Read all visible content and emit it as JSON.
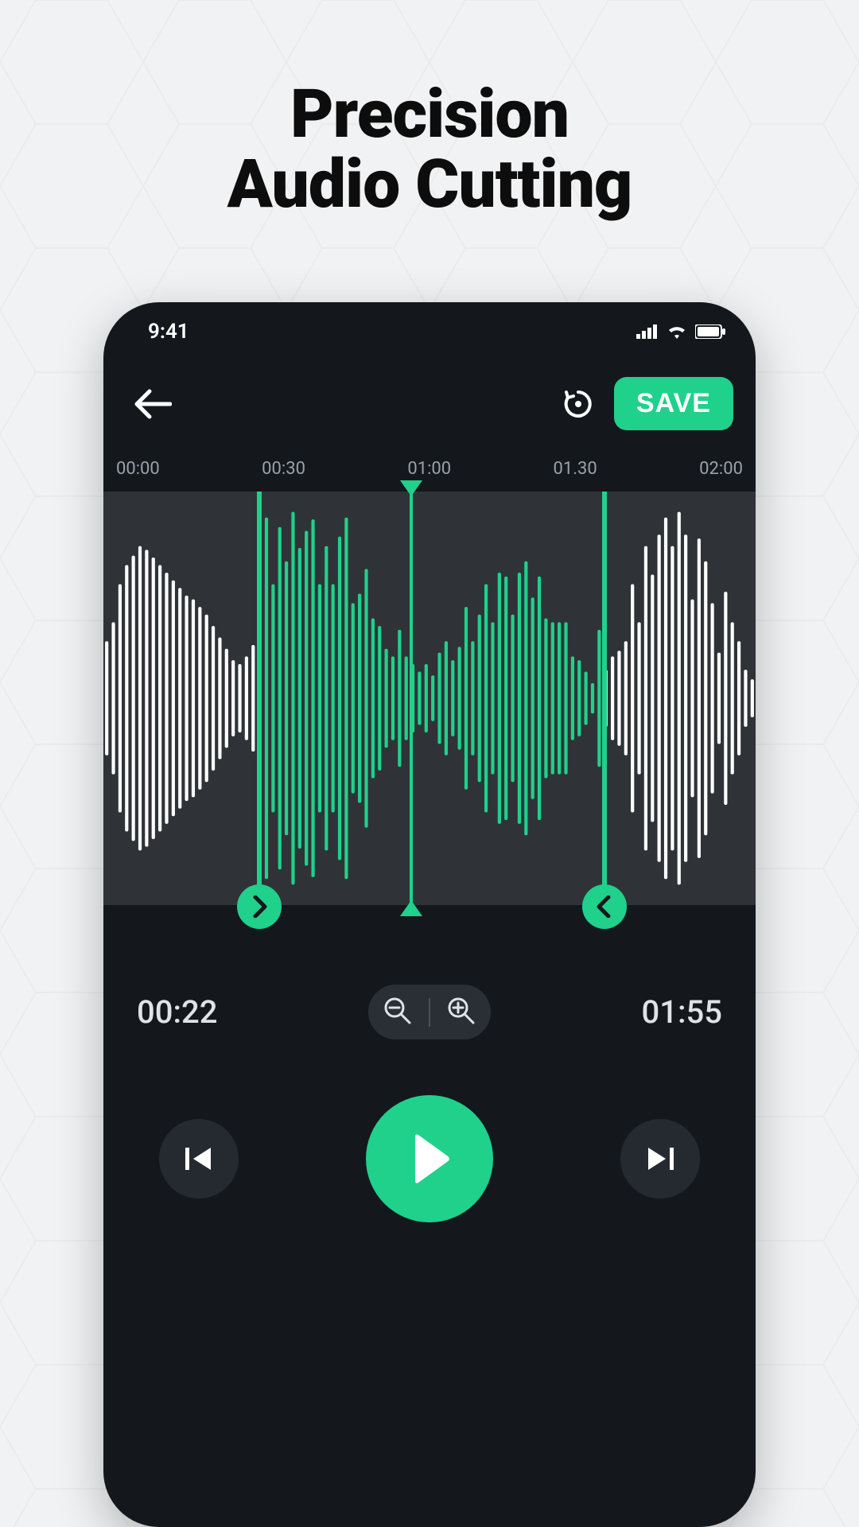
{
  "headline": {
    "line1": "Precision",
    "line2": "Audio Cutting"
  },
  "statusbar": {
    "time": "9:41"
  },
  "topbar": {
    "save_label": "SAVE"
  },
  "ruler": [
    "00:00",
    "00:30",
    "01:00",
    "01.30",
    "02:00"
  ],
  "times": {
    "start": "00:22",
    "end": "01:55"
  },
  "selection": {
    "start_pct": 23.5,
    "end_pct": 76.5,
    "playhead_pct": 47
  },
  "colors": {
    "accent": "#1fd18b",
    "phone_bg": "#14181d",
    "wave_band": "#2f3338"
  },
  "waveform": [
    30,
    40,
    60,
    70,
    75,
    80,
    78,
    74,
    70,
    66,
    62,
    58,
    54,
    52,
    48,
    44,
    38,
    32,
    26,
    20,
    18,
    22,
    28,
    40,
    95,
    60,
    90,
    72,
    98,
    79,
    88,
    94,
    60,
    80,
    60,
    85,
    95,
    50,
    55,
    68,
    42,
    38,
    26,
    22,
    36,
    22,
    18,
    14,
    18,
    12,
    24,
    30,
    20,
    27,
    48,
    30,
    44,
    60,
    40,
    66,
    64,
    44,
    66,
    72,
    53,
    64,
    42,
    40,
    40,
    40,
    22,
    20,
    14,
    8,
    36,
    15,
    22,
    25,
    30,
    60,
    40,
    80,
    65,
    86,
    95,
    80,
    98,
    86,
    52,
    84,
    72,
    50,
    24,
    56,
    40,
    30,
    15,
    10
  ]
}
